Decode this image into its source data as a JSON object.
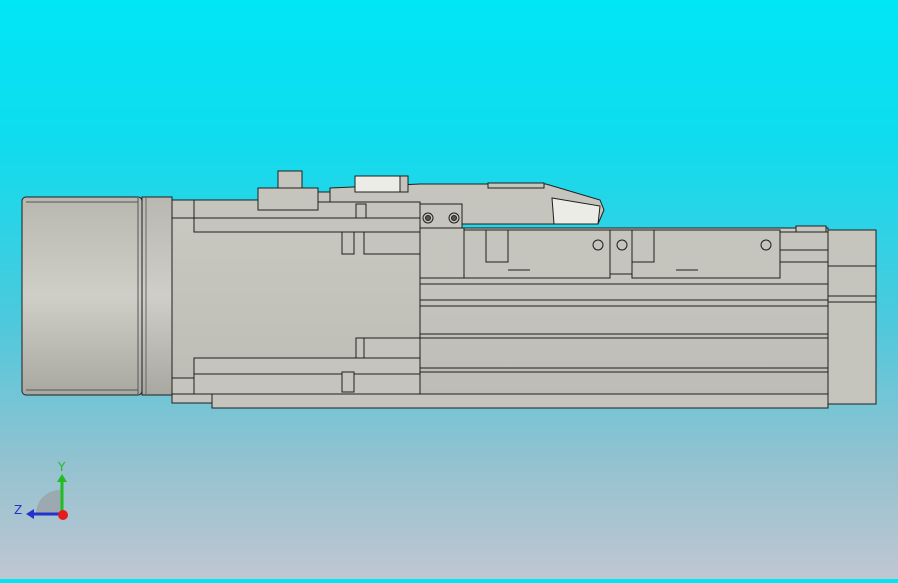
{
  "viewport": {
    "background_top": "#00e6f5",
    "background_bottom": "#c0c6d2",
    "part_fill": "#c5c5bd",
    "part_edge": "#1e1e1e",
    "highlight_fill": "#ecece6"
  },
  "triad": {
    "y_label": "Y",
    "z_label": "Z",
    "y_color": "#22bb22",
    "z_color": "#2233cc",
    "origin_color": "#e51c1c"
  }
}
